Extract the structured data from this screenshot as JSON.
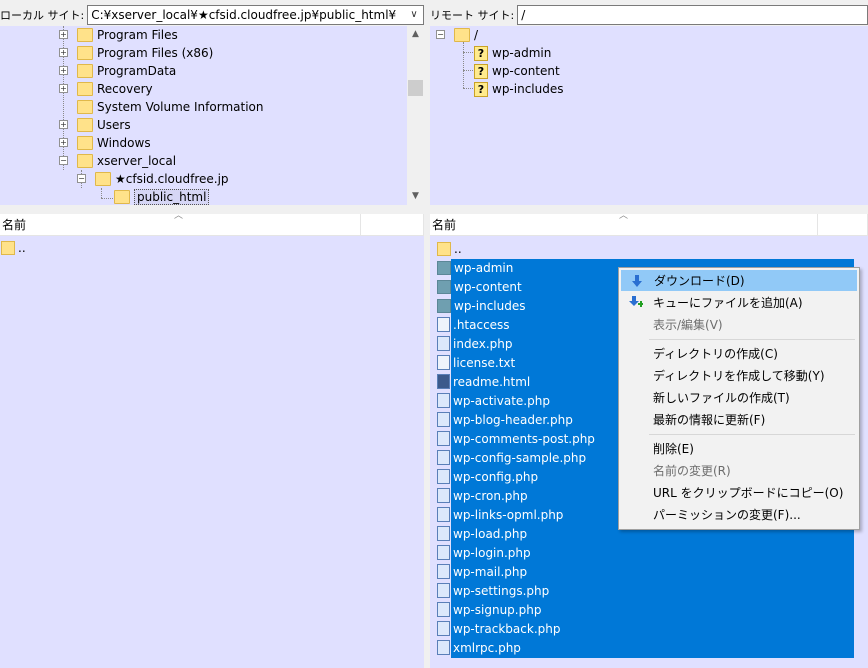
{
  "local": {
    "site_label": "ローカル サイト:",
    "path": "C:¥xserver_local¥★cfsid.cloudfree.jp¥public_html¥",
    "tree": [
      "Program Files",
      "Program Files (x86)",
      "ProgramData",
      "Recovery",
      "System Volume Information",
      "Users",
      "Windows",
      "xserver_local",
      "★cfsid.cloudfree.jp",
      "public_html"
    ],
    "list_header": "名前",
    "list_items": [
      ".."
    ]
  },
  "remote": {
    "site_label": "リモート サイト:",
    "path": "/",
    "tree_root": "/",
    "tree": [
      "wp-admin",
      "wp-content",
      "wp-includes"
    ],
    "list_header": "名前",
    "list_items": [
      "..",
      "wp-admin",
      "wp-content",
      "wp-includes",
      ".htaccess",
      "index.php",
      "license.txt",
      "readme.html",
      "wp-activate.php",
      "wp-blog-header.php",
      "wp-comments-post.php",
      "wp-config-sample.php",
      "wp-config.php",
      "wp-cron.php",
      "wp-links-opml.php",
      "wp-load.php",
      "wp-login.php",
      "wp-mail.php",
      "wp-settings.php",
      "wp-signup.php",
      "wp-trackback.php",
      "xmlrpc.php"
    ]
  },
  "context_menu": {
    "download": "ダウンロード(D)",
    "add_to_queue": "キューにファイルを追加(A)",
    "view_edit": "表示/編集(V)",
    "create_dir": "ディレクトリの作成(C)",
    "create_dir_enter": "ディレクトリを作成して移動(Y)",
    "create_file": "新しいファイルの作成(T)",
    "refresh": "最新の情報に更新(F)",
    "delete": "削除(E)",
    "rename": "名前の変更(R)",
    "copy_url": "URL をクリップボードにコピー(O)",
    "permissions": "パーミッションの変更(F)..."
  },
  "colors": {
    "pane_bg": "#e0e0ff",
    "selection": "#0078d7",
    "menu_highlight": "#91c9f7"
  }
}
